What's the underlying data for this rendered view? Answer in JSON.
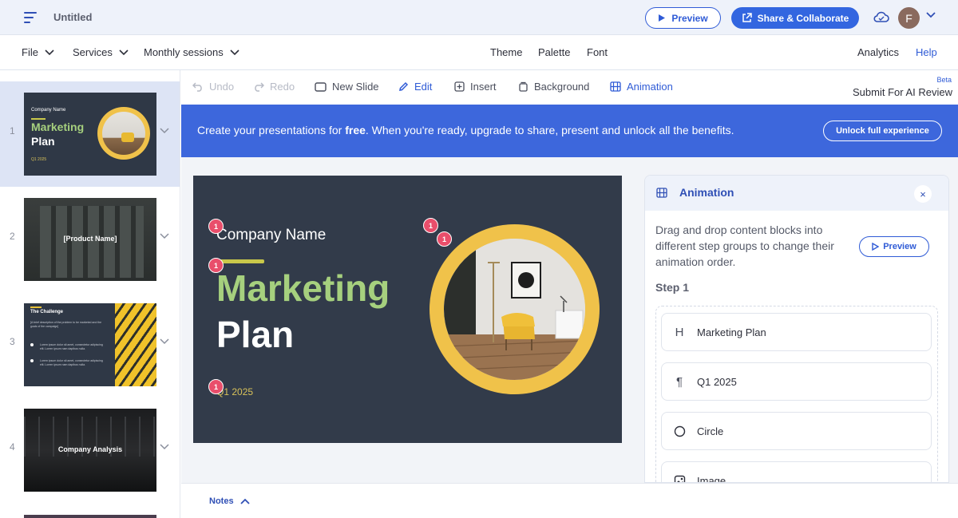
{
  "topbar": {
    "title": "Untitled",
    "preview_label": "Preview",
    "share_label": "Share & Collaborate",
    "avatar_letter": "F"
  },
  "menubar": {
    "file": "File",
    "services": "Services",
    "sessions": "Monthly sessions",
    "theme": "Theme",
    "palette": "Palette",
    "font": "Font",
    "analytics": "Analytics",
    "help": "Help"
  },
  "toolbar": {
    "undo": "Undo",
    "redo": "Redo",
    "new_slide": "New Slide",
    "edit": "Edit",
    "insert": "Insert",
    "background": "Background",
    "animation": "Animation",
    "beta": "Beta",
    "ai_review": "Submit For AI Review"
  },
  "banner": {
    "text_before": "Create your presentations for ",
    "text_bold": "free",
    "text_after": ". When you're ready, upgrade to share, present and unlock all the benefits.",
    "unlock_label": "Unlock full experience"
  },
  "slides": [
    {
      "num": "1",
      "company": "Company Name",
      "title1": "Marketing",
      "title2": "Plan",
      "date": "Q1 2025"
    },
    {
      "num": "2",
      "label": "[Product Name]"
    },
    {
      "num": "3",
      "title": "The Challenge",
      "desc": "[A brief description of the problem to be marketed and the goals of the campaign]",
      "bullet1": "Lorem ipsum dolor sit amet, consectetur adipiscing elit. Lorem ipsum nam dapibus nulla.",
      "bullet2": "Lorem ipsum dolor sit amet, consectetur adipiscing elit. Lorem ipsum nam dapibus nulla."
    },
    {
      "num": "4",
      "label": "Company Analysis"
    }
  ],
  "canvas": {
    "company": "Company Name",
    "title1": "Marketing",
    "title2": "Plan",
    "date": "Q1 2025",
    "badge": "1"
  },
  "animation_panel": {
    "title": "Animation",
    "close": "×",
    "description": "Drag and drop content blocks into different step groups to change their animation order.",
    "preview_label": "Preview",
    "step_label": "Step 1",
    "blocks": [
      {
        "icon": "H",
        "label": "Marketing Plan"
      },
      {
        "icon": "¶",
        "label": "Q1 2025"
      },
      {
        "icon": "○",
        "label": "Circle"
      },
      {
        "icon": "image",
        "label": "Image"
      }
    ]
  },
  "notes": {
    "label": "Notes"
  },
  "colors": {
    "accent": "#3366e0",
    "banner": "#3d67dc",
    "slide_bg": "#323b4a",
    "slide_green": "#a6d07e",
    "slide_yellow": "#f0c24a",
    "badge": "#e94e6b"
  }
}
